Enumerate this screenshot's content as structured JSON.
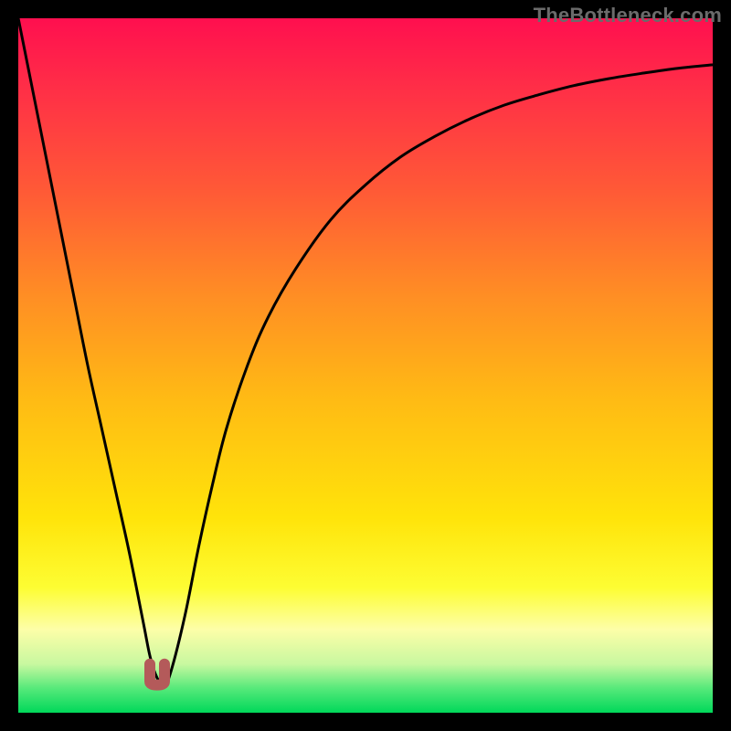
{
  "attribution": "TheBottleneck.com",
  "colors": {
    "frame": "#000000",
    "gradient_stops": [
      {
        "offset": 0.0,
        "color": "#ff0f4f"
      },
      {
        "offset": 0.1,
        "color": "#ff2e47"
      },
      {
        "offset": 0.25,
        "color": "#ff5a36"
      },
      {
        "offset": 0.4,
        "color": "#ff8e24"
      },
      {
        "offset": 0.55,
        "color": "#ffbb14"
      },
      {
        "offset": 0.72,
        "color": "#ffe40a"
      },
      {
        "offset": 0.82,
        "color": "#fdfd33"
      },
      {
        "offset": 0.88,
        "color": "#fdfea8"
      },
      {
        "offset": 0.93,
        "color": "#c8f8a0"
      },
      {
        "offset": 0.965,
        "color": "#56e97a"
      },
      {
        "offset": 1.0,
        "color": "#00d85a"
      }
    ],
    "curve": "#000000",
    "marker": "#b45a5a"
  },
  "chart_data": {
    "type": "line",
    "title": "",
    "xlabel": "",
    "ylabel": "",
    "xlim": [
      0,
      100
    ],
    "ylim": [
      0,
      100
    ],
    "grid": false,
    "legend": false,
    "series": [
      {
        "name": "bottleneck-curve",
        "x": [
          0,
          2,
          4,
          6,
          8,
          10,
          12,
          14,
          16,
          18,
          19,
          20,
          21,
          22,
          24,
          26,
          28,
          30,
          33,
          36,
          40,
          45,
          50,
          55,
          60,
          65,
          70,
          75,
          80,
          85,
          90,
          95,
          100
        ],
        "y": [
          100,
          90,
          80,
          70,
          60,
          50,
          41,
          32,
          23,
          13,
          8,
          5,
          4,
          6,
          14,
          24,
          33,
          41,
          50,
          57,
          64,
          71,
          76,
          80,
          83,
          85.5,
          87.5,
          89,
          90.3,
          91.3,
          92.1,
          92.8,
          93.3
        ]
      }
    ],
    "minimum_marker": {
      "x": 20,
      "y": 4
    }
  }
}
